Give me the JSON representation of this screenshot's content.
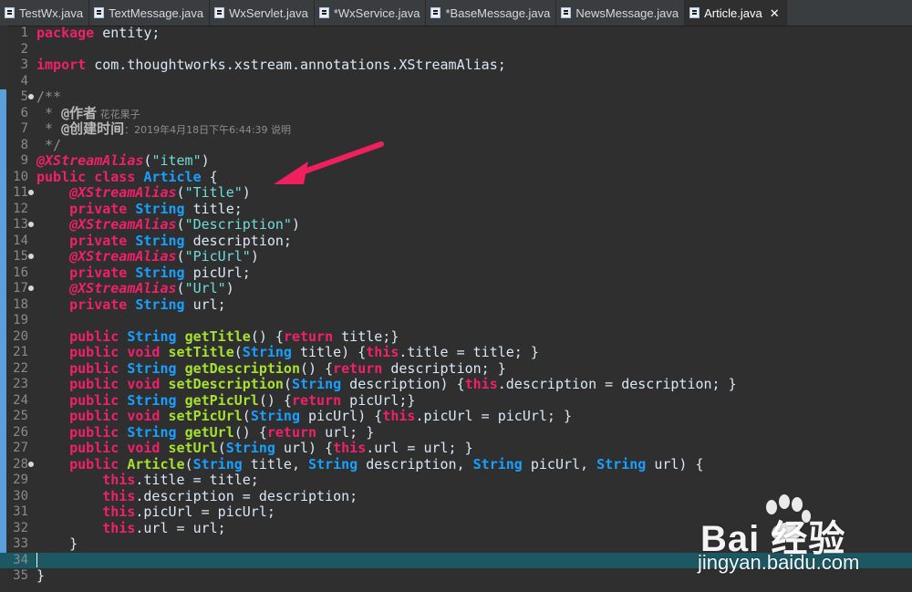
{
  "tabs": [
    {
      "label": "TestWx.java",
      "active": false
    },
    {
      "label": "TextMessage.java",
      "active": false
    },
    {
      "label": "WxServlet.java",
      "active": false
    },
    {
      "label": "*WxService.java",
      "active": false
    },
    {
      "label": "*BaseMessage.java",
      "active": false
    },
    {
      "label": "NewsMessage.java",
      "active": false
    },
    {
      "label": "Article.java",
      "active": true
    }
  ],
  "tab_close_symbol": "✕",
  "lines": [
    {
      "n": "1",
      "html": "<span class=\"k\">package</span> entity;"
    },
    {
      "n": "2",
      "html": ""
    },
    {
      "n": "3",
      "html": "<span class=\"k\">import</span> com.thoughtworks.xstream.annotations.XStreamAlias;"
    },
    {
      "n": "4",
      "html": ""
    },
    {
      "n": "5",
      "fold": true,
      "html": "<span class=\"c\">/**</span>"
    },
    {
      "n": "6",
      "html": "<span class=\"c\"> * </span><span class=\"cb\">@作者</span><span class=\"cz\"> 花花果子</span>"
    },
    {
      "n": "7",
      "html": "<span class=\"c\"> * </span><span class=\"cb\">@创建时间</span><span class=\"cz\">：2019年4月18日下午6:44:39 说明</span>"
    },
    {
      "n": "8",
      "html": "<span class=\"c\"> */</span>"
    },
    {
      "n": "9",
      "html": "<span class=\"a\">@XStreamAlias</span>(<span class=\"s\">\"item\"</span>)"
    },
    {
      "n": "10",
      "html": "<span class=\"k\">public class</span> <span class=\"cls\">Article</span> {"
    },
    {
      "n": "11",
      "fold": true,
      "html": "    <span class=\"a\">@XStreamAlias</span>(<span class=\"s\">\"Title\"</span>)"
    },
    {
      "n": "12",
      "html": "    <span class=\"k\">private</span> <span class=\"t\">String</span> title;"
    },
    {
      "n": "13",
      "fold": true,
      "html": "    <span class=\"a\">@XStreamAlias</span>(<span class=\"s\">\"Description\"</span>)"
    },
    {
      "n": "14",
      "html": "    <span class=\"k\">private</span> <span class=\"t\">String</span> description;"
    },
    {
      "n": "15",
      "fold": true,
      "html": "    <span class=\"a\">@XStreamAlias</span>(<span class=\"s\">\"PicUrl\"</span>)"
    },
    {
      "n": "16",
      "html": "    <span class=\"k\">private</span> <span class=\"t\">String</span> picUrl;"
    },
    {
      "n": "17",
      "fold": true,
      "html": "    <span class=\"a\">@XStreamAlias</span>(<span class=\"s\">\"Url\"</span>)"
    },
    {
      "n": "18",
      "html": "    <span class=\"k\">private</span> <span class=\"t\">String</span> url;"
    },
    {
      "n": "19",
      "html": ""
    },
    {
      "n": "20",
      "html": "    <span class=\"k\">public</span> <span class=\"t\">String</span> <span class=\"m\">getTitle</span>() {<span class=\"k\">return</span> title;}"
    },
    {
      "n": "21",
      "html": "    <span class=\"k\">public void</span> <span class=\"m\">setTitle</span>(<span class=\"t\">String</span> title) {<span class=\"k\">this</span>.title = title; }"
    },
    {
      "n": "22",
      "html": "    <span class=\"k\">public</span> <span class=\"t\">String</span> <span class=\"m\">getDescription</span>() {<span class=\"k\">return</span> description; }"
    },
    {
      "n": "23",
      "html": "    <span class=\"k\">public void</span> <span class=\"m\">setDescription</span>(<span class=\"t\">String</span> description) {<span class=\"k\">this</span>.description = description; }"
    },
    {
      "n": "24",
      "html": "    <span class=\"k\">public</span> <span class=\"t\">String</span> <span class=\"m\">getPicUrl</span>() {<span class=\"k\">return</span> picUrl;}"
    },
    {
      "n": "25",
      "html": "    <span class=\"k\">public void</span> <span class=\"m\">setPicUrl</span>(<span class=\"t\">String</span> picUrl) {<span class=\"k\">this</span>.picUrl = picUrl; }"
    },
    {
      "n": "26",
      "html": "    <span class=\"k\">public</span> <span class=\"t\">String</span> <span class=\"m\">getUrl</span>() {<span class=\"k\">return</span> url; }"
    },
    {
      "n": "27",
      "html": "    <span class=\"k\">public void</span> <span class=\"m\">setUrl</span>(<span class=\"t\">String</span> url) {<span class=\"k\">this</span>.url = url; }"
    },
    {
      "n": "28",
      "fold": true,
      "html": "    <span class=\"k\">public</span> <span class=\"m\">Article</span>(<span class=\"t\">String</span> title, <span class=\"t\">String</span> description, <span class=\"t\">String</span> picUrl, <span class=\"t\">String</span> url) {"
    },
    {
      "n": "29",
      "html": "        <span class=\"k\">this</span>.title = title;"
    },
    {
      "n": "30",
      "html": "        <span class=\"k\">this</span>.description = description;"
    },
    {
      "n": "31",
      "html": "        <span class=\"k\">this</span>.picUrl = picUrl;"
    },
    {
      "n": "32",
      "html": "        <span class=\"k\">this</span>.url = url;"
    },
    {
      "n": "33",
      "html": "    }"
    },
    {
      "n": "34",
      "current": true,
      "html": "<span class=\"caret\"></span>"
    },
    {
      "n": "35",
      "html": "}"
    }
  ],
  "watermark": {
    "brand": "Bai  经验",
    "url": "jingyan.baidu.com"
  },
  "colors": {
    "keyword": "#f0206a",
    "type": "#18a0ff",
    "string": "#6fdcd8",
    "current_line": "#1c5864",
    "arrow": "#f0205e"
  }
}
